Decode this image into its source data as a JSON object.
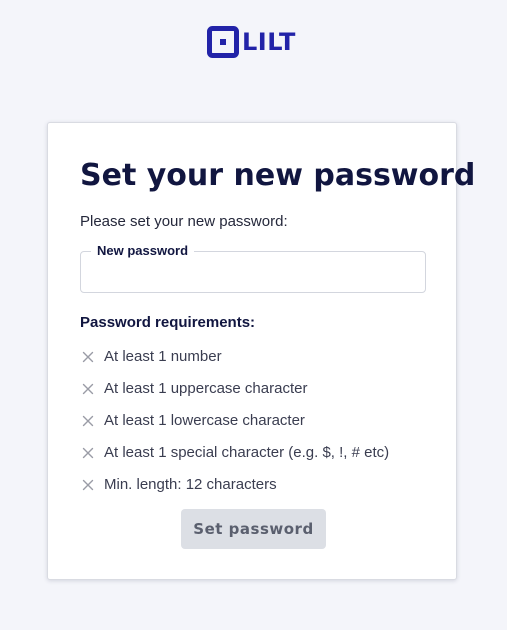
{
  "brand": {
    "name": "LILT",
    "color": "#2223a8",
    "logo_icon": "lilt-logo-icon"
  },
  "form": {
    "title": "Set your new password",
    "intro": "Please set your new password:",
    "password_field": {
      "label": "New password",
      "value": "",
      "placeholder": ""
    },
    "requirements_heading": "Password requirements:",
    "requirements": [
      {
        "text": "At least 1 number",
        "met": false,
        "icon": "x-icon"
      },
      {
        "text": "At least 1 uppercase character",
        "met": false,
        "icon": "x-icon"
      },
      {
        "text": "At least 1 lowercase character",
        "met": false,
        "icon": "x-icon"
      },
      {
        "text": "At least 1 special character (e.g. $, !, # etc)",
        "met": false,
        "icon": "x-icon"
      },
      {
        "text": "Min. length: 12 characters",
        "met": false,
        "icon": "x-icon"
      }
    ],
    "submit_label": "Set password",
    "submit_disabled": true
  },
  "colors": {
    "page_background": "#f4f5fa",
    "heading": "#111640",
    "unmet_icon": "#9a9ca6",
    "disabled_button": "#dcdfe5"
  }
}
